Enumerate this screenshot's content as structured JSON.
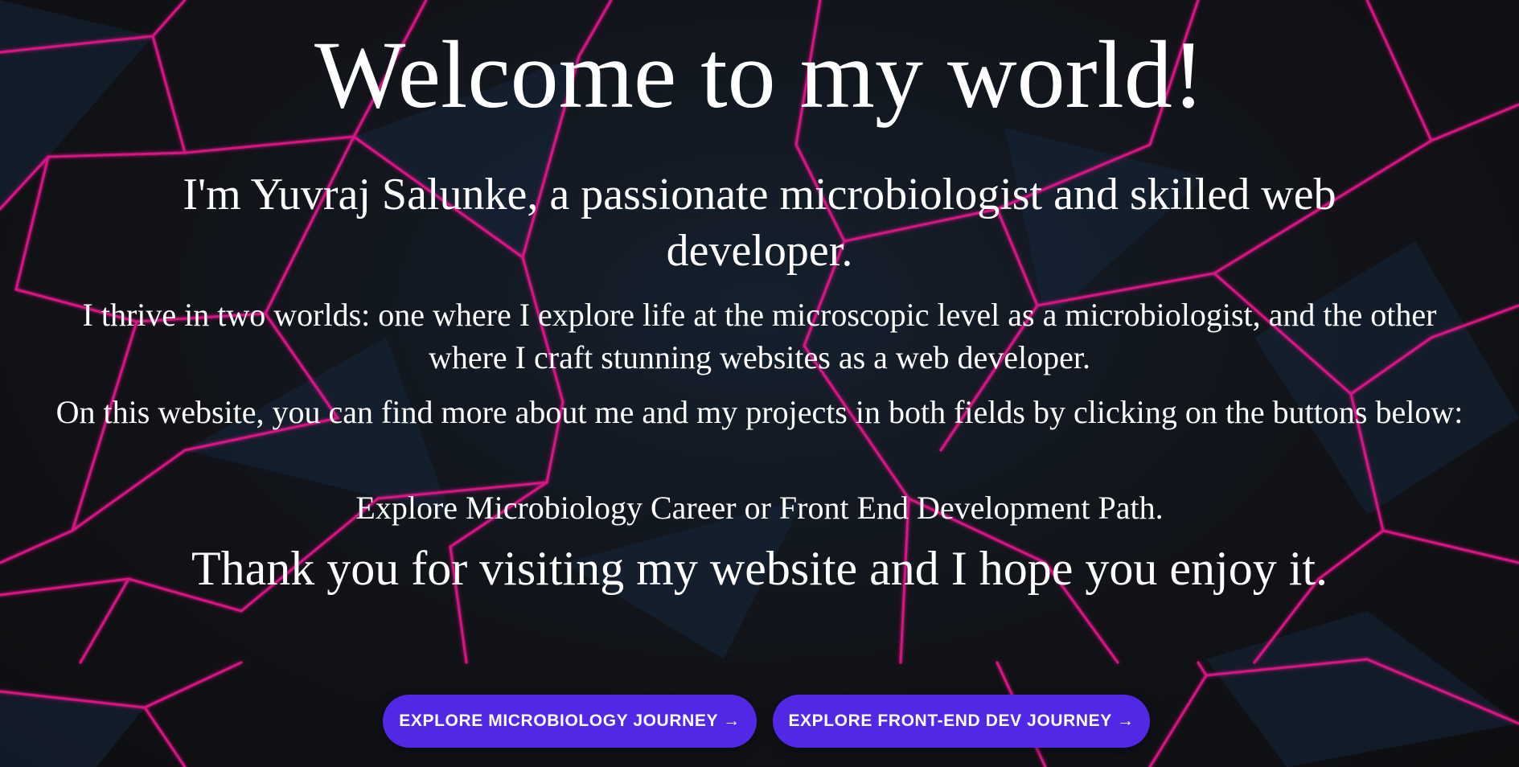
{
  "colors": {
    "background": "#111214",
    "accent_lines": "#e6128c",
    "button": "#5227e6",
    "text": "#ffffff"
  },
  "hero": {
    "title": "Welcome to my world!",
    "intro": "I'm Yuvraj Salunke, a passionate microbiologist and skilled web developer.",
    "paragraph_1": "I thrive in two worlds: one where I explore life at the microscopic level as a microbiologist, and the other where I craft stunning websites as a web developer.",
    "paragraph_2": "On this website, you can find more about me and my projects in both fields by clicking on the buttons below:",
    "paragraph_3": "Explore Microbiology Career or Front End Development Path.",
    "thanks": "Thank you for visiting my website and I hope you enjoy it."
  },
  "actions": {
    "microbiology_button": "EXPLORE MICROBIOLOGY JOURNEY →",
    "frontend_button": "EXPLORE FRONT-END DEV JOURNEY →"
  }
}
